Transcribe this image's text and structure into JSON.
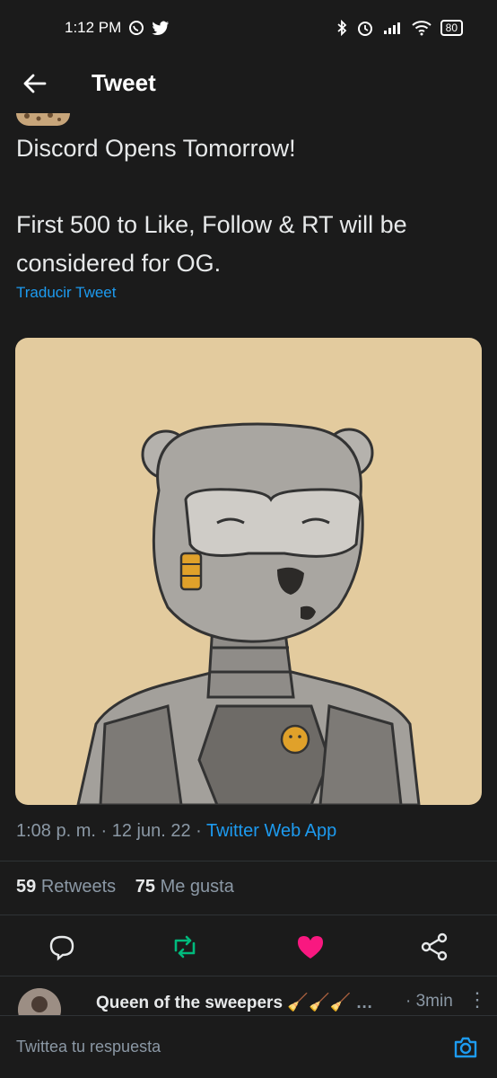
{
  "status_bar": {
    "time": "1:12 PM",
    "battery": "80",
    "icons": [
      "whatsapp-icon",
      "twitter-icon",
      "bluetooth-icon",
      "alarm-icon",
      "signal-icon",
      "wifi-icon",
      "battery-icon"
    ]
  },
  "header": {
    "title": "Tweet"
  },
  "tweet": {
    "line1": "Discord Opens Tomorrow!",
    "line2": "First 500 to Like, Follow & RT will be considered for OG.",
    "translate": "Traducir Tweet",
    "time": "1:08 p. m.",
    "date": "12 jun. 22",
    "source": "Twitter Web App",
    "retweets_count": "59",
    "retweets_label": "Retweets",
    "likes_count": "75",
    "likes_label": "Me gusta"
  },
  "reply": {
    "name": "Queen of the sweepers",
    "emojis": "🧹🧹🧹",
    "ellipsis": "…",
    "time": "· 3min",
    "more": "⋮"
  },
  "composer": {
    "placeholder": "Twittea tu respuesta"
  },
  "colors": {
    "accent": "#1d9bf0",
    "like": "#f91880",
    "retweet": "#00ba7c",
    "background": "#1b1b1b"
  }
}
